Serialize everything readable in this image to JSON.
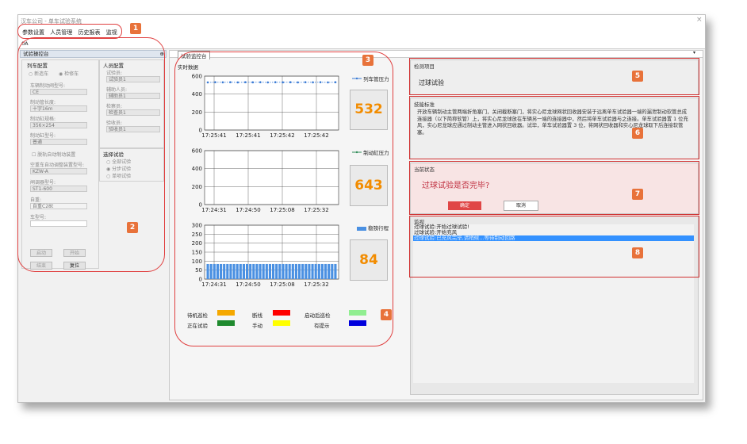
{
  "window": {
    "title": "汉车公司 - 单车试验系统",
    "close_icon": "close-icon"
  },
  "menu": [
    "参数设置",
    "人员管理",
    "历史报表",
    "监视"
  ],
  "tab": {
    "label": "0A"
  },
  "left_panel": {
    "title": "试验操控台",
    "vehicle_config": {
      "title": "列车配置",
      "radios": [
        "新造车",
        "检修车"
      ],
      "fields": [
        {
          "label": "车辆制动阀型号:",
          "value": "CE"
        },
        {
          "label": "制动管长度:",
          "value": "十字16m"
        },
        {
          "label": "制动缸规格:",
          "value": "356×254"
        },
        {
          "label": "制动缸型号:",
          "value": "普通"
        }
      ],
      "checkbox": "脱轨自动制动装置",
      "empty_load_label": "空重车自动调整装置型号:",
      "empty_load_value": "KZW-A",
      "valve_label": "闸调器型号:",
      "valve_value": "ST1-600",
      "weight_label": "自重:",
      "weight_value": "自重C28t",
      "car_no_label": "车型号:",
      "car_no_value": ""
    },
    "staff_config": {
      "title": "人员配置",
      "fields": [
        {
          "label": "试验员:",
          "value": "试验员1"
        },
        {
          "label": "辅助人员:",
          "value": "辅助员1"
        },
        {
          "label": "检察员:",
          "value": "检查员1"
        },
        {
          "label": "验收员:",
          "value": "验收员1"
        }
      ]
    },
    "select_test": {
      "title": "选择试验",
      "options": [
        "全部试验",
        "分步试验",
        "单项试验"
      ]
    },
    "buttons": {
      "start": "启动",
      "pause": "开始",
      "stop": "结束",
      "reset": "复位"
    }
  },
  "center": {
    "panel_title": "试验监控台",
    "realtime_label": "实时数据",
    "readout1": "532",
    "readout2": "643",
    "readout3": "84"
  },
  "chart_data": [
    {
      "type": "line",
      "title": "",
      "series": [
        {
          "name": "列车管压力",
          "x": [
            "17:25:41",
            "17:25:41",
            "17:25:42",
            "17:25:42"
          ],
          "values": [
            530,
            532,
            531,
            532
          ]
        }
      ],
      "ylim": [
        0,
        600
      ],
      "yticks": [
        0,
        200,
        400,
        600
      ],
      "xticks": [
        "17:25:41",
        "17:25:41",
        "17:25:42",
        "17:25:42"
      ],
      "color": "#3a7bd5",
      "grid": true,
      "legend": "top-right"
    },
    {
      "type": "line",
      "title": "",
      "series": [
        {
          "name": "制动缸压力",
          "values": []
        }
      ],
      "ylim": [
        0,
        600
      ],
      "yticks": [
        0,
        200,
        400,
        600
      ],
      "xticks": [
        "17:24:31",
        "17:24:50",
        "17:25:08",
        "17:25:32"
      ],
      "color": "#2e8b57",
      "grid": true,
      "legend": "top-right"
    },
    {
      "type": "bar",
      "title": "",
      "series": [
        {
          "name": "稳镑行程",
          "values": [
            84,
            84,
            84,
            84,
            84,
            84,
            84,
            84,
            84,
            84,
            84,
            84,
            84,
            84,
            84,
            84,
            84,
            84,
            84,
            84,
            84,
            84,
            84,
            84,
            84,
            84,
            84,
            84,
            84,
            84,
            84,
            84,
            84,
            84,
            84,
            84,
            84,
            84,
            84,
            84
          ]
        }
      ],
      "ylim": [
        0,
        300
      ],
      "yticks": [
        0,
        50,
        100,
        150,
        200,
        250,
        300
      ],
      "xticks": [
        "17:24:31",
        "17:24:50",
        "17:25:08",
        "17:25:32"
      ],
      "color": "#4a90e2",
      "grid": true,
      "legend": "top-right"
    }
  ],
  "legend": [
    {
      "label": "待机巡检",
      "color": "#f5a800"
    },
    {
      "label": "断线",
      "color": "#ff0000"
    },
    {
      "label": "启动后巡检",
      "color": "#90ee90"
    },
    {
      "label": "正在试验",
      "color": "#1f8a2e"
    },
    {
      "label": "手动",
      "color": "#ffff00"
    },
    {
      "label": "有提示",
      "color": "#0000dd"
    }
  ],
  "right": {
    "item_title": "检测项目",
    "item_value": "过球试验",
    "standard_title": "技能标准",
    "standard_text": "开放车辆制动主管两端折角塞门，关闭截断塞门，将实心尼龙球网状回收器安装于远离单车试验器一端的漏泄制动软管总成连接器（以下简称软管）上，将实心尼龙球放在车辆另一端的连接器中，然后将单车试验器与之连接。单车试验器置 1 位充风，实心尼龙球应通过制动主管进入网状回收器。试毕，单车试验器置 3 位，将网状回收器和实心尼龙球取下后连接软管塞。",
    "status_title": "当前状态",
    "status_question": "过球试验是否完毕?",
    "confirm": "确定",
    "cancel": "取消",
    "monitor_title": "监视",
    "monitor_lines": [
      "过球试验:开始过球试验!",
      "过球试验:开始充风",
      "过球试验:已充风完毕,请稍候...等待制动回路"
    ]
  },
  "badges": [
    "1",
    "2",
    "3",
    "4",
    "5",
    "6",
    "7",
    "8"
  ]
}
